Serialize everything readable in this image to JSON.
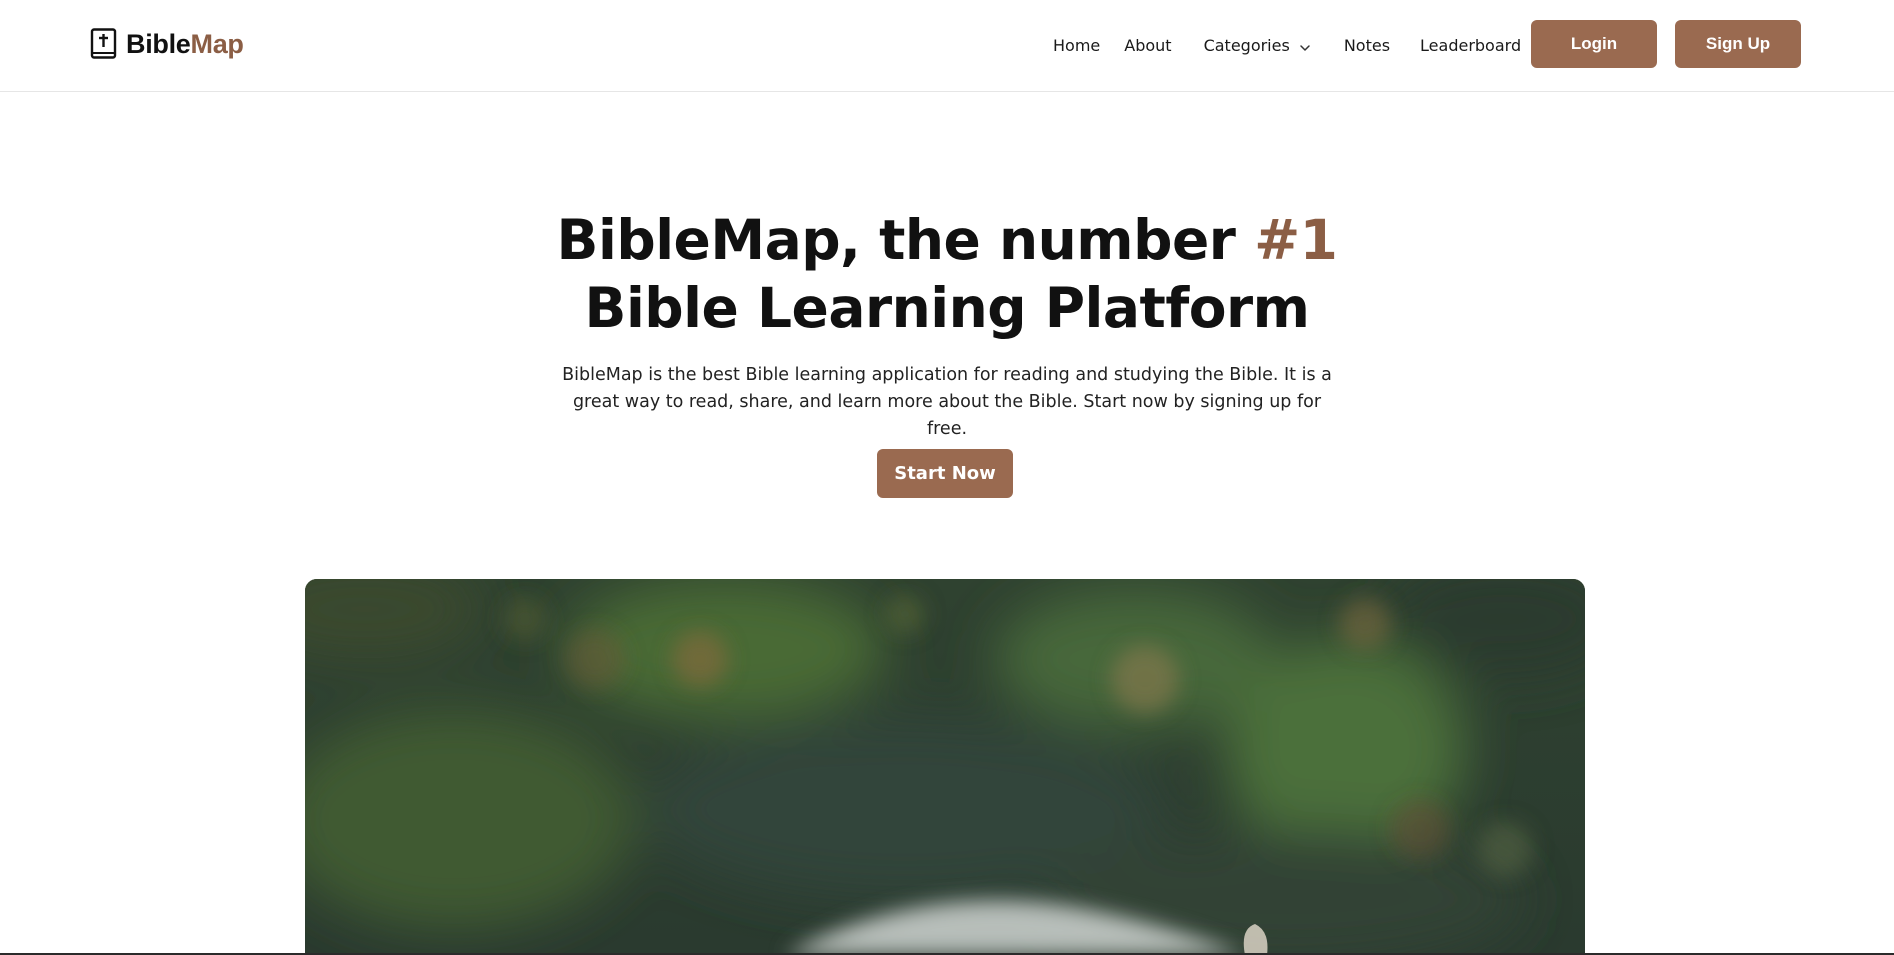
{
  "header": {
    "logo": {
      "icon": "bible-cross-icon",
      "text_part1": "Bible",
      "text_part2": "Map"
    },
    "nav": {
      "home": "Home",
      "about": "About",
      "categories": "Categories",
      "categories_icon": "chevron-down-icon",
      "notes": "Notes",
      "leaderboard": "Leaderboard"
    },
    "login_label": "Login",
    "signup_label": "Sign Up"
  },
  "hero": {
    "title_line1_prefix": "BibleMap, the number ",
    "title_line1_accent": "#1",
    "title_line2": "Bible Learning Platform",
    "subtitle": "BibleMap is the best Bible learning application for reading and studying the Bible. It is a great way to read, share, and learn more about the Bible. Start now by signing up for free.",
    "cta_label": "Start Now",
    "image": "blurred-green-bokeh-with-open-book"
  },
  "colors": {
    "accent": "#9a6a50",
    "accent_text": "#8b5e45",
    "text": "#111111",
    "background": "#ffffff"
  }
}
